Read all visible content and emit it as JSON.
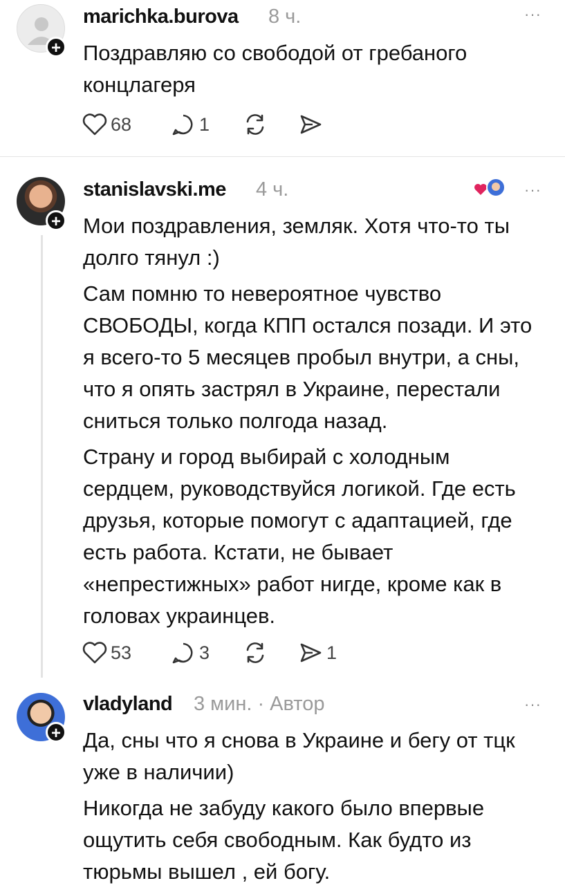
{
  "posts": [
    {
      "username": "marichka.burova",
      "time": "8 ч.",
      "text": [
        "Поздравляю со свободой от гребаного концлагеря"
      ],
      "likes": "68",
      "replies": "1",
      "shares": ""
    },
    {
      "username": "stanislavski.me",
      "time": "4 ч.",
      "text": [
        "Мои поздравления, земляк. Хотя что-то ты долго тянул :)",
        "Сам помню то невероятное чувство СВОБОДЫ, когда КПП остался позади. И это я всего-то 5 месяцев пробыл внутри, а сны, что я опять застрял в Украине, перестали сниться только полгода назад.",
        "Страну и город выбирай с холодным сердцем, руководствуйся логикой. Где есть друзья, которые помогут с адаптацией, где есть работа. Кстати, не бывает «непрестижных» работ нигде, кроме как в головах украинцев."
      ],
      "likes": "53",
      "replies": "3",
      "shares": "1"
    },
    {
      "username": "vladyland",
      "time": "3 мин. · Автор",
      "text": [
        "Да, сны что я снова в Украине и бегу от тцк уже в наличии)",
        "Никогда не забуду какого было впервые ощутить себя свободным. Как будто из тюрьмы вышел , ей богу."
      ]
    }
  ],
  "ui": {
    "more_glyph": "···",
    "follow_glyph": "+",
    "colors": {
      "text": "#111111",
      "muted": "#9a9a9a",
      "divider": "#e3e3e3",
      "like_heart": "#e0245e"
    },
    "icons": [
      "heart-icon",
      "reply-icon",
      "repost-icon",
      "share-icon",
      "more-icon",
      "plus-icon"
    ]
  }
}
